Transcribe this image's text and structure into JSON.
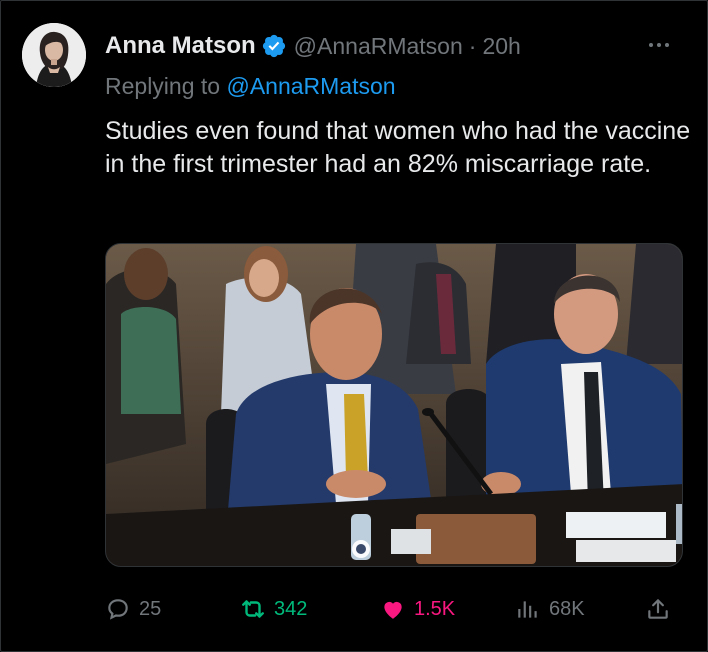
{
  "tweet": {
    "author_name": "Anna Matson",
    "author_handle": "@AnnaRMatson",
    "separator": "·",
    "time": "20h",
    "verified": true,
    "replying_prefix": "Replying to",
    "replying_to": "@AnnaRMatson",
    "text": "Studies even found that women who had the vaccine in the first trimester had an 82% miscarriage rate."
  },
  "media": {
    "type": "photo",
    "icon": "hearing-photo"
  },
  "actions": {
    "replies": "25",
    "retweets": "342",
    "likes": "1.5K",
    "views": "68K"
  },
  "colors": {
    "background": "#000000",
    "text": "#e7e9ea",
    "secondary": "#71767b",
    "link": "#1d9bf0",
    "retweet_active": "#00ba7c",
    "like_active": "#f91880"
  }
}
